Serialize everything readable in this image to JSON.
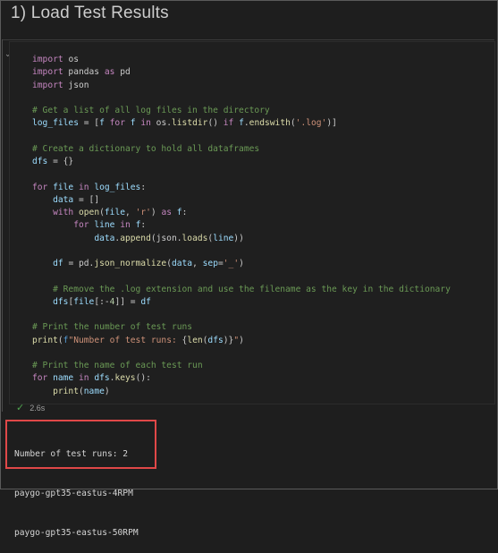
{
  "notebook": {
    "heading": "1) Load Test Results"
  },
  "cell": {
    "exec_time": "2.6s",
    "code_lines": [
      [
        [
          "kw",
          "import"
        ],
        [
          "p",
          " "
        ],
        [
          "p",
          "os"
        ]
      ],
      [
        [
          "kw",
          "import"
        ],
        [
          "p",
          " pandas "
        ],
        [
          "kw",
          "as"
        ],
        [
          "p",
          " pd"
        ]
      ],
      [
        [
          "kw",
          "import"
        ],
        [
          "p",
          " json"
        ]
      ],
      [],
      [
        [
          "cm",
          "# Get a list of all log files in the directory"
        ]
      ],
      [
        [
          "var",
          "log_files"
        ],
        [
          "p",
          " = ["
        ],
        [
          "var",
          "f"
        ],
        [
          "p",
          " "
        ],
        [
          "kw",
          "for"
        ],
        [
          "p",
          " "
        ],
        [
          "var",
          "f"
        ],
        [
          "p",
          " "
        ],
        [
          "kw",
          "in"
        ],
        [
          "p",
          " os."
        ],
        [
          "fn",
          "listdir"
        ],
        [
          "p",
          "() "
        ],
        [
          "kw",
          "if"
        ],
        [
          "p",
          " "
        ],
        [
          "var",
          "f"
        ],
        [
          "p",
          "."
        ],
        [
          "fn",
          "endswith"
        ],
        [
          "p",
          "("
        ],
        [
          "str",
          "'.log'"
        ],
        [
          "p",
          ")]"
        ]
      ],
      [],
      [
        [
          "cm",
          "# Create a dictionary to hold all dataframes"
        ]
      ],
      [
        [
          "var",
          "dfs"
        ],
        [
          "p",
          " = {}"
        ]
      ],
      [],
      [
        [
          "kw",
          "for"
        ],
        [
          "p",
          " "
        ],
        [
          "var",
          "file"
        ],
        [
          "p",
          " "
        ],
        [
          "kw",
          "in"
        ],
        [
          "p",
          " "
        ],
        [
          "var",
          "log_files"
        ],
        [
          "p",
          ":"
        ]
      ],
      [
        [
          "p",
          "    "
        ],
        [
          "var",
          "data"
        ],
        [
          "p",
          " = []"
        ]
      ],
      [
        [
          "p",
          "    "
        ],
        [
          "kw",
          "with"
        ],
        [
          "p",
          " "
        ],
        [
          "fn",
          "open"
        ],
        [
          "p",
          "("
        ],
        [
          "var",
          "file"
        ],
        [
          "p",
          ", "
        ],
        [
          "str",
          "'r'"
        ],
        [
          "p",
          ") "
        ],
        [
          "kw",
          "as"
        ],
        [
          "p",
          " "
        ],
        [
          "var",
          "f"
        ],
        [
          "p",
          ":"
        ]
      ],
      [
        [
          "p",
          "        "
        ],
        [
          "kw",
          "for"
        ],
        [
          "p",
          " "
        ],
        [
          "var",
          "line"
        ],
        [
          "p",
          " "
        ],
        [
          "kw",
          "in"
        ],
        [
          "p",
          " "
        ],
        [
          "var",
          "f"
        ],
        [
          "p",
          ":"
        ]
      ],
      [
        [
          "p",
          "            "
        ],
        [
          "var",
          "data"
        ],
        [
          "p",
          "."
        ],
        [
          "fn",
          "append"
        ],
        [
          "p",
          "(json."
        ],
        [
          "fn",
          "loads"
        ],
        [
          "p",
          "("
        ],
        [
          "var",
          "line"
        ],
        [
          "p",
          "))"
        ]
      ],
      [],
      [
        [
          "p",
          "    "
        ],
        [
          "var",
          "df"
        ],
        [
          "p",
          " = pd."
        ],
        [
          "fn",
          "json_normalize"
        ],
        [
          "p",
          "("
        ],
        [
          "var",
          "data"
        ],
        [
          "p",
          ", "
        ],
        [
          "var",
          "sep"
        ],
        [
          "p",
          "="
        ],
        [
          "str",
          "'_'"
        ],
        [
          "p",
          ")"
        ]
      ],
      [],
      [
        [
          "p",
          "    "
        ],
        [
          "cm",
          "# Remove the .log extension and use the filename as the key in the dictionary"
        ]
      ],
      [
        [
          "p",
          "    "
        ],
        [
          "var",
          "dfs"
        ],
        [
          "p",
          "["
        ],
        [
          "var",
          "file"
        ],
        [
          "p",
          "[:-"
        ],
        [
          "num",
          "4"
        ],
        [
          "p",
          "]] = "
        ],
        [
          "var",
          "df"
        ]
      ],
      [],
      [
        [
          "cm",
          "# Print the number of test runs"
        ]
      ],
      [
        [
          "fn",
          "print"
        ],
        [
          "p",
          "("
        ],
        [
          "kwb",
          "f"
        ],
        [
          "str",
          "\"Number of test runs: "
        ],
        [
          "p",
          "{"
        ],
        [
          "fn",
          "len"
        ],
        [
          "p",
          "("
        ],
        [
          "var",
          "dfs"
        ],
        [
          "p",
          ")}"
        ],
        [
          "str",
          "\""
        ],
        [
          "p",
          ")"
        ]
      ],
      [],
      [
        [
          "cm",
          "# Print the name of each test run"
        ]
      ],
      [
        [
          "kw",
          "for"
        ],
        [
          "p",
          " "
        ],
        [
          "var",
          "name"
        ],
        [
          "p",
          " "
        ],
        [
          "kw",
          "in"
        ],
        [
          "p",
          " "
        ],
        [
          "var",
          "dfs"
        ],
        [
          "p",
          "."
        ],
        [
          "fn",
          "keys"
        ],
        [
          "p",
          "():"
        ]
      ],
      [
        [
          "p",
          "    "
        ],
        [
          "fn",
          "print"
        ],
        [
          "p",
          "("
        ],
        [
          "var",
          "name"
        ],
        [
          "p",
          ")"
        ]
      ]
    ],
    "output_lines": [
      "Number of test runs: 2",
      "paygo-gpt35-eastus-4RPM",
      "paygo-gpt35-eastus-50RPM"
    ]
  },
  "icons": {
    "collapse": "chevron-down-icon",
    "status": "check-icon"
  },
  "colors": {
    "highlight_border": "#e04848",
    "success": "#4fa44f"
  }
}
